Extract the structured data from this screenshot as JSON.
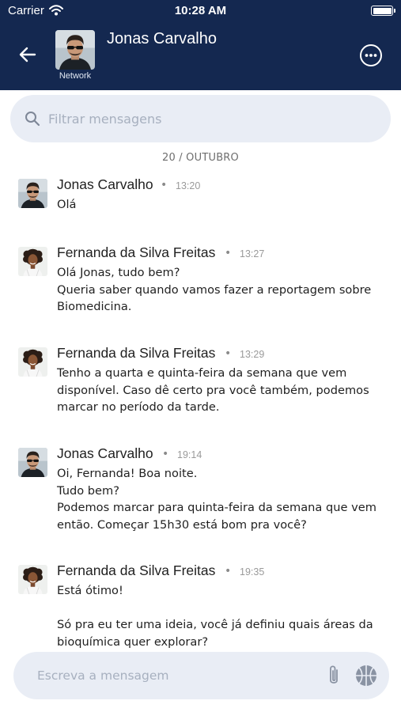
{
  "status_bar": {
    "carrier": "Carrier",
    "time": "10:28 AM"
  },
  "header": {
    "contact_name": "Jonas Carvalho",
    "avatar_caption": "Network",
    "back_icon": "arrow-left-icon",
    "more_icon": "more-options-icon"
  },
  "search": {
    "placeholder": "Filtrar mensagens"
  },
  "date_separator": "20 / OUTUBRO",
  "messages": [
    {
      "sender": "Jonas Carvalho",
      "time": "13:20",
      "text": "Olá"
    },
    {
      "sender": "Fernanda da Silva Freitas",
      "time": "13:27",
      "text": "Olá Jonas, tudo bem?\nQueria saber quando vamos fazer a reportagem sobre Biomedicina."
    },
    {
      "sender": "Fernanda da Silva Freitas",
      "time": "13:29",
      "text": "Tenho a quarta e quinta-feira da semana que vem disponível. Caso dê certo pra você também, podemos marcar no período da tarde."
    },
    {
      "sender": "Jonas Carvalho",
      "time": "19:14",
      "text": "Oi, Fernanda! Boa noite.\nTudo bem?\nPodemos marcar para quinta-feira da semana que vem então. Começar 15h30 está bom pra você?"
    },
    {
      "sender": "Fernanda da Silva Freitas",
      "time": "19:35",
      "text": "Está ótimo!\n\nSó pra eu ter uma ideia, você já definiu quais áreas da bioquímica quer explorar?"
    }
  ],
  "composer": {
    "placeholder": "Escreva a mensagem"
  },
  "colors": {
    "header_bg": "#142850",
    "field_bg": "#e9edf5",
    "placeholder": "#a7b0bf"
  }
}
